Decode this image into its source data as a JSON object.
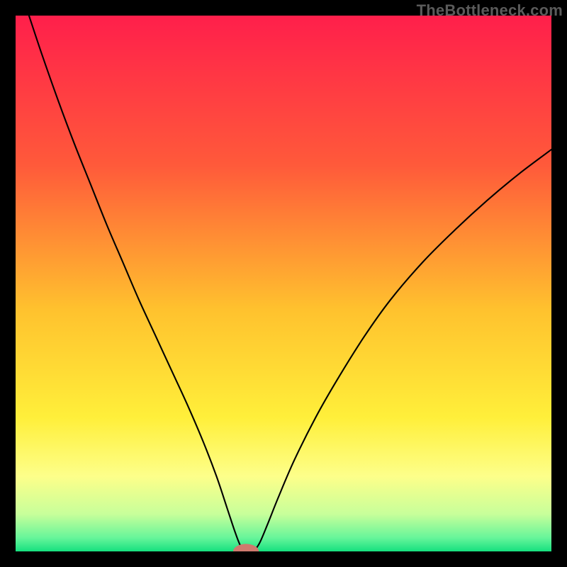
{
  "watermark": "TheBottleneck.com",
  "chart_data": {
    "type": "line",
    "title": "",
    "xlabel": "",
    "ylabel": "",
    "xlim": [
      0,
      100
    ],
    "ylim": [
      0,
      100
    ],
    "grid": false,
    "legend": false,
    "background_gradient_stops": [
      {
        "offset": 0.0,
        "color": "#ff1f4b"
      },
      {
        "offset": 0.28,
        "color": "#ff5a3a"
      },
      {
        "offset": 0.55,
        "color": "#ffc22e"
      },
      {
        "offset": 0.75,
        "color": "#ffef3a"
      },
      {
        "offset": 0.86,
        "color": "#fdff8a"
      },
      {
        "offset": 0.93,
        "color": "#c8ff9a"
      },
      {
        "offset": 0.975,
        "color": "#66f59a"
      },
      {
        "offset": 1.0,
        "color": "#16e07f"
      }
    ],
    "marker": {
      "x": 43,
      "y": 0,
      "color": "#cf7a6e",
      "rx": 2.4,
      "ry": 1.4
    },
    "series": [
      {
        "name": "curve",
        "stroke": "#000000",
        "stroke_width": 2.1,
        "points": [
          {
            "x": 2.5,
            "y": 100.0
          },
          {
            "x": 5.0,
            "y": 92.5
          },
          {
            "x": 8.0,
            "y": 84.0
          },
          {
            "x": 11.0,
            "y": 76.0
          },
          {
            "x": 14.0,
            "y": 68.5
          },
          {
            "x": 17.0,
            "y": 61.0
          },
          {
            "x": 20.0,
            "y": 54.0
          },
          {
            "x": 23.0,
            "y": 47.0
          },
          {
            "x": 26.0,
            "y": 40.5
          },
          {
            "x": 29.0,
            "y": 34.0
          },
          {
            "x": 32.0,
            "y": 27.5
          },
          {
            "x": 35.0,
            "y": 20.5
          },
          {
            "x": 37.5,
            "y": 14.0
          },
          {
            "x": 39.5,
            "y": 8.0
          },
          {
            "x": 41.0,
            "y": 3.5
          },
          {
            "x": 42.0,
            "y": 1.0
          },
          {
            "x": 43.0,
            "y": 0.0
          },
          {
            "x": 44.3,
            "y": 0.0
          },
          {
            "x": 45.5,
            "y": 1.5
          },
          {
            "x": 47.0,
            "y": 5.0
          },
          {
            "x": 49.0,
            "y": 10.0
          },
          {
            "x": 52.0,
            "y": 17.0
          },
          {
            "x": 56.0,
            "y": 25.0
          },
          {
            "x": 60.0,
            "y": 32.0
          },
          {
            "x": 65.0,
            "y": 40.0
          },
          {
            "x": 70.0,
            "y": 47.0
          },
          {
            "x": 76.0,
            "y": 54.0
          },
          {
            "x": 82.0,
            "y": 60.0
          },
          {
            "x": 88.0,
            "y": 65.5
          },
          {
            "x": 94.0,
            "y": 70.5
          },
          {
            "x": 100.0,
            "y": 75.0
          }
        ]
      }
    ]
  }
}
